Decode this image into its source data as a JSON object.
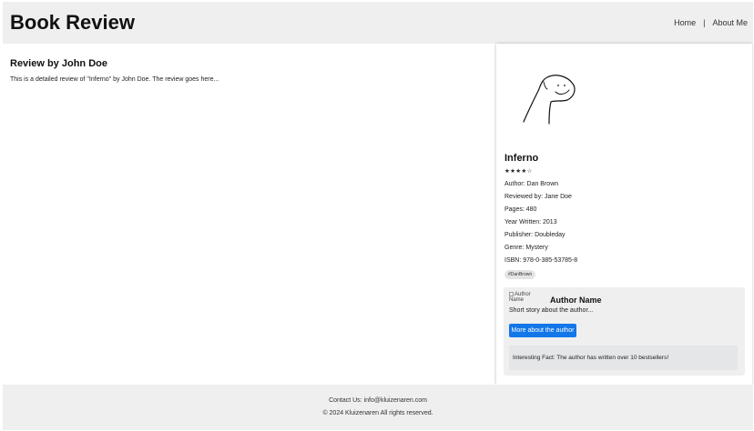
{
  "header": {
    "title": "Book Review",
    "nav": [
      {
        "label": "Home"
      },
      {
        "label": "About Me"
      }
    ],
    "separator": "|"
  },
  "review": {
    "heading": "Review by John Doe",
    "body": "This is a detailed review of \"Inferno\" by John Doe. The review goes here..."
  },
  "book": {
    "title": "Inferno",
    "rating": 4,
    "rating_max": 5,
    "rating_text": "★★★★☆",
    "meta": {
      "author": "Author: Dan Brown",
      "reviewed_by": "Reviewed by: Jane Doe",
      "pages": "Pages: 480",
      "year": "Year Written: 2013",
      "publisher": "Publisher: Doubleday",
      "genre": "Genre: Mystery",
      "isbn": "ISBN: 978-0-385-53785-8"
    },
    "tag": "#DanBrown"
  },
  "author": {
    "img_alt": "Author Name",
    "name": "Author Name",
    "bio": "Short story about the author...",
    "button": "More about the author",
    "fact": "Interesting Fact: The author has written over 10 bestsellers!"
  },
  "footer": {
    "contact": "Contact Us: info@kluizenaren.com",
    "copyright": "© 2024 Kluizenaren All rights reserved."
  },
  "colors": {
    "header_bg": "#efefef",
    "accent_button": "#1477e8",
    "card_bg": "#efefef"
  }
}
